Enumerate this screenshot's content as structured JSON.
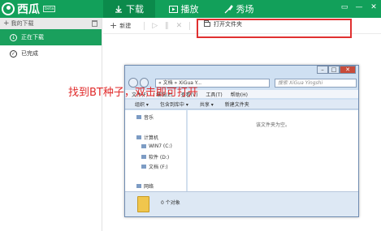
{
  "app": {
    "name": "西瓜",
    "badge": "beta"
  },
  "tabs": [
    {
      "label": "下载",
      "active": true
    },
    {
      "label": "播放",
      "active": false
    },
    {
      "label": "秀场",
      "active": false
    }
  ],
  "window_controls": [
    "▭",
    "—",
    "✕"
  ],
  "sidebar": {
    "header": "我的下载",
    "items": [
      {
        "label": "正在下载",
        "active": true
      },
      {
        "label": "已完成",
        "active": false
      }
    ]
  },
  "toolbar": {
    "new_label": "新建",
    "open_folder_label": "打开文件夹"
  },
  "explorer": {
    "address": "« 文档 » XiGua Y...",
    "search_placeholder": "搜索 XiGua Yingshi",
    "menu": [
      "文件(F)",
      "编辑(E)",
      "查看(V)",
      "工具(T)",
      "帮助(H)"
    ],
    "commands": [
      "组织 ▾",
      "包含到库中 ▾",
      "共享 ▾",
      "新建文件夹"
    ],
    "nav": [
      {
        "label": "音乐"
      },
      {
        "label": "计算机"
      },
      {
        "label": "WIN7 (C:)"
      },
      {
        "label": "软件 (D:)"
      },
      {
        "label": "文档 (F:)"
      },
      {
        "label": "网络"
      }
    ],
    "empty_message": "该文件夹为空。",
    "status": "0 个对象"
  },
  "annotation": {
    "hint_text": "找到BT种子，双击即可打开",
    "color": "#e02a2a"
  },
  "colors": {
    "brand_green": "#12a05a",
    "active_tab": "#0b8a4b",
    "highlight_box": "#e03030"
  }
}
